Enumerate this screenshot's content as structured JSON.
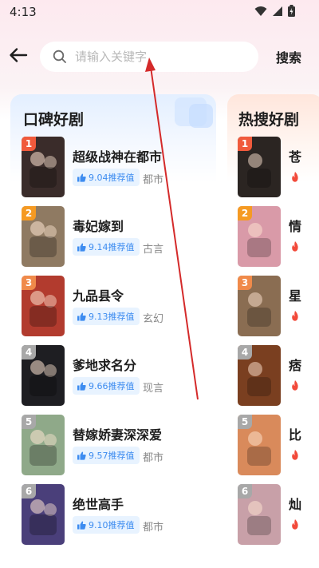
{
  "status": {
    "time": "4:13"
  },
  "search": {
    "placeholder": "请输入关键字",
    "button_label": "搜索"
  },
  "left_card": {
    "title": "口碑好剧",
    "items": [
      {
        "rank": "1",
        "title": "超级战神在都市",
        "score": "9.04推荐值",
        "genre": "都市",
        "poster_color": "#3a2c2a",
        "poster_caption": "超级战神在都市"
      },
      {
        "rank": "2",
        "title": "毒妃嫁到",
        "score": "9.14推荐值",
        "genre": "古言",
        "poster_color": "#8f7a62",
        "poster_caption": "毒妃嫁到"
      },
      {
        "rank": "3",
        "title": "九品县令",
        "score": "9.13推荐值",
        "genre": "玄幻",
        "poster_color": "#b23b2e",
        "poster_caption": "九品县令"
      },
      {
        "rank": "4",
        "title": "爹地求名分",
        "score": "9.66推荐值",
        "genre": "现言",
        "poster_color": "#1e1e22",
        "poster_caption": "爹地求名分"
      },
      {
        "rank": "5",
        "title": "替嫁娇妻深深爱",
        "score": "9.57推荐值",
        "genre": "都市",
        "poster_color": "#8fa989",
        "poster_caption": "替嫁娇妻深深爱"
      },
      {
        "rank": "6",
        "title": "绝世高手",
        "score": "9.10推荐值",
        "genre": "都市",
        "poster_color": "#4a3f7a",
        "poster_caption": "绝世高手"
      }
    ]
  },
  "right_card": {
    "title": "热搜好剧",
    "items": [
      {
        "rank": "1",
        "title": "苍",
        "poster_color": "#2b2522"
      },
      {
        "rank": "2",
        "title": "情",
        "poster_color": "#d99aa8"
      },
      {
        "rank": "3",
        "title": "星",
        "poster_color": "#8a6d52"
      },
      {
        "rank": "4",
        "title": "痞",
        "poster_color": "#7a3f20"
      },
      {
        "rank": "5",
        "title": "比",
        "poster_color": "#d98a5b"
      },
      {
        "rank": "6",
        "title": "灿",
        "poster_color": "#c8a0a8"
      }
    ]
  },
  "rank_colors": [
    "#f05a3c",
    "#f59a23",
    "#f08a4a",
    "#a8a8a8",
    "#a8a8a8",
    "#a8a8a8"
  ],
  "colors": {
    "accent": "#3d8cf0",
    "flame": "#f24a3a",
    "annotation_arrow": "#d42a2a"
  }
}
